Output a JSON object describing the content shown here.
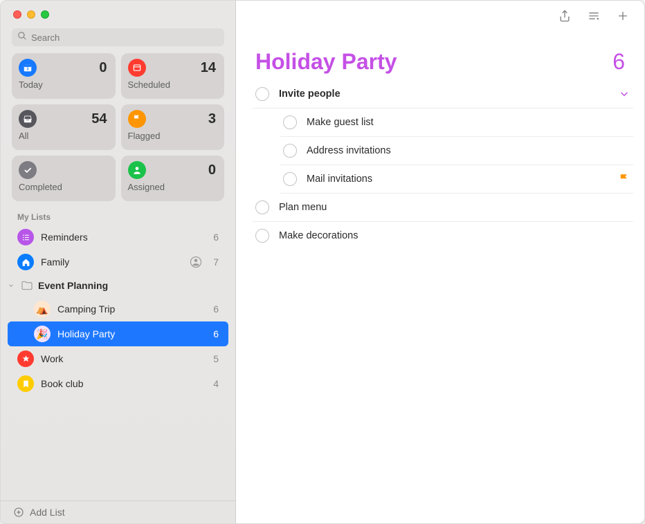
{
  "search": {
    "placeholder": "Search"
  },
  "smart": {
    "today": {
      "label": "Today",
      "count": 0
    },
    "scheduled": {
      "label": "Scheduled",
      "count": 14
    },
    "all": {
      "label": "All",
      "count": 54
    },
    "flagged": {
      "label": "Flagged",
      "count": 3
    },
    "completed": {
      "label": "Completed",
      "count": ""
    },
    "assigned": {
      "label": "Assigned",
      "count": 0
    }
  },
  "sidebar": {
    "section": "My Lists",
    "reminders": {
      "label": "Reminders",
      "count": 6
    },
    "family": {
      "label": "Family",
      "count": 7
    },
    "folder": {
      "label": "Event Planning"
    },
    "camping": {
      "label": "Camping Trip",
      "count": 6
    },
    "holiday": {
      "label": "Holiday Party",
      "count": 6
    },
    "work": {
      "label": "Work",
      "count": 5
    },
    "bookclub": {
      "label": "Book club",
      "count": 4
    },
    "addList": "Add List"
  },
  "main": {
    "title": "Holiday Party",
    "count": 6,
    "items": {
      "invite": "Invite people",
      "guest": "Make guest list",
      "address": "Address invitations",
      "mail": "Mail invitations",
      "menu": "Plan menu",
      "decor": "Make decorations"
    }
  }
}
